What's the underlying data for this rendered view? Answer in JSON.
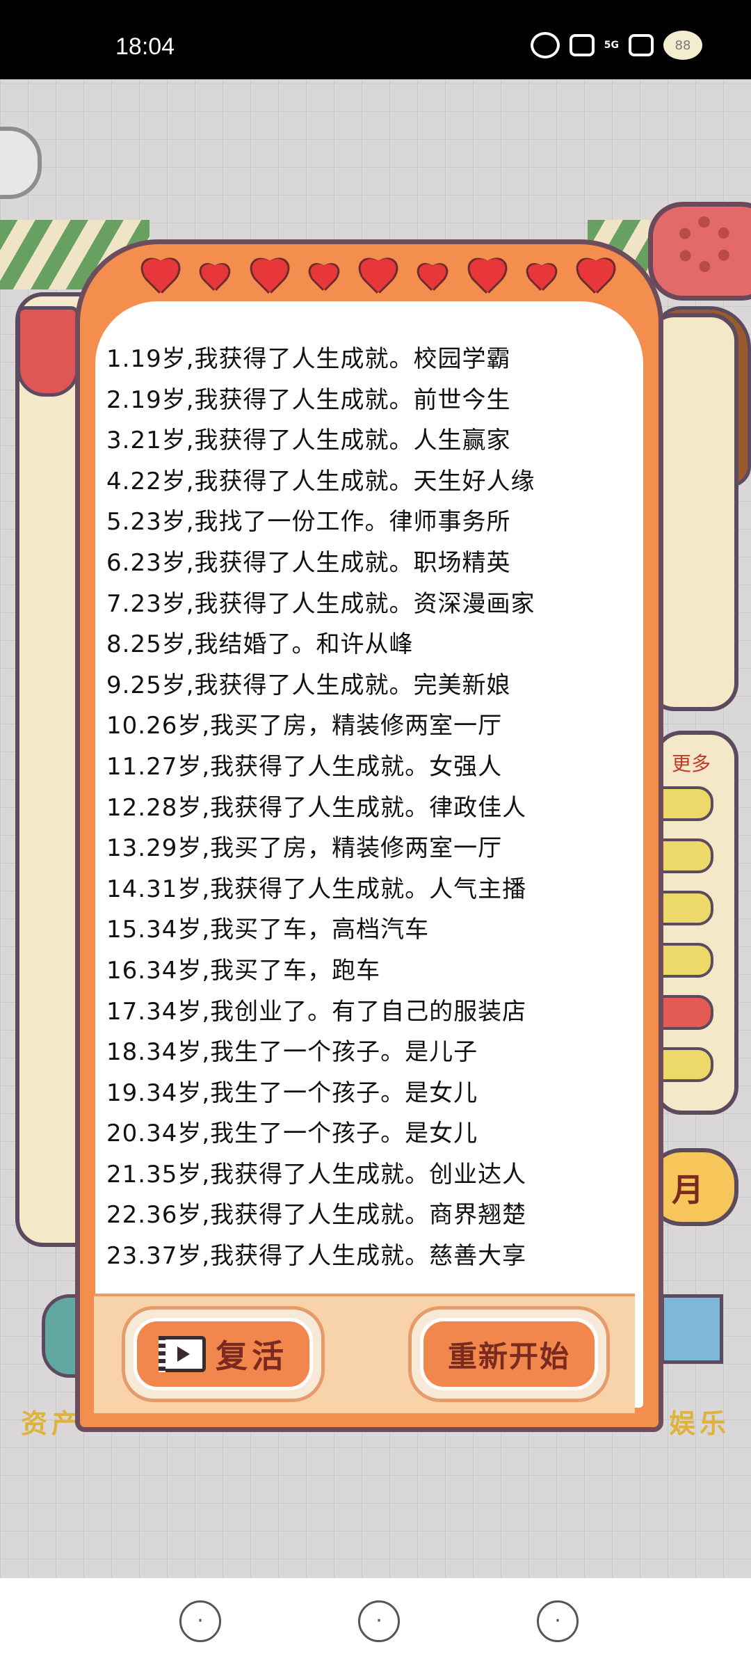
{
  "status_bar": {
    "time": "18:04",
    "network": "5G",
    "battery": "88"
  },
  "dialog": {
    "events": [
      "1.19岁,我获得了人生成就。校园学霸",
      "2.19岁,我获得了人生成就。前世今生",
      "3.21岁,我获得了人生成就。人生赢家",
      "4.22岁,我获得了人生成就。天生好人缘",
      "5.23岁,我找了一份工作。律师事务所",
      "6.23岁,我获得了人生成就。职场精英",
      "7.23岁,我获得了人生成就。资深漫画家",
      "8.25岁,我结婚了。和许从峰",
      "9.25岁,我获得了人生成就。完美新娘",
      "10.26岁,我买了房，精装修两室一厅",
      "11.27岁,我获得了人生成就。女强人",
      "12.28岁,我获得了人生成就。律政佳人",
      "13.29岁,我买了房，精装修两室一厅",
      "14.31岁,我获得了人生成就。人气主播",
      "15.34岁,我买了车，高档汽车",
      "16.34岁,我买了车，跑车",
      "17.34岁,我创业了。有了自己的服装店",
      "18.34岁,我生了一个孩子。是儿子",
      "19.34岁,我生了一个孩子。是女儿",
      "20.34岁,我生了一个孩子。是女儿",
      "21.35岁,我获得了人生成就。创业达人",
      "22.36岁,我获得了人生成就。商界翘楚",
      "23.37岁,我获得了人生成就。慈善大享"
    ],
    "revive_label": "复活",
    "restart_label": "重新开始"
  },
  "background": {
    "more_label": "更多",
    "month_label": "月",
    "bottom_strip_left": "资产",
    "bottom_strip_right": "娱乐"
  },
  "colors": {
    "dialog_bg": "#f38e4f",
    "heart": "#e8373a",
    "button": "#f2874d"
  },
  "bottom_nav": {
    "items": [
      "home-dog-icon",
      "dog-icon",
      "dog-wink-icon"
    ]
  }
}
